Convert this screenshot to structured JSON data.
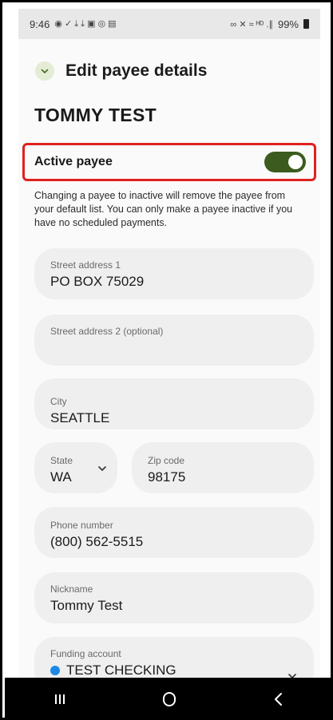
{
  "status_bar": {
    "time": "9:46",
    "left_icons": "◉ ✓ ⤓ ⤓ ▣ ◎ ▤",
    "right_icons": "∞ ✕ ≈ ᴴᴰ .∥",
    "battery": "99%"
  },
  "header": {
    "back_icon": "chevron-down-icon",
    "title": "Edit payee details"
  },
  "payee": {
    "name": "TOMMY TEST"
  },
  "active_payee": {
    "label": "Active payee",
    "enabled": true,
    "toggle_color": "#3b5b1f",
    "highlight_color": "#e02020"
  },
  "help_text": "Changing a payee to inactive will remove the payee from your default list. You can only make a payee inactive if you have no scheduled payments.",
  "fields": {
    "street1": {
      "label": "Street address 1",
      "value": "PO BOX 75029"
    },
    "street2": {
      "label": "Street address 2 (optional)",
      "value": ""
    },
    "city": {
      "label": "City",
      "value": "SEATTLE"
    },
    "state": {
      "label": "State",
      "value": "WA"
    },
    "zip": {
      "label": "Zip code",
      "value": "98175"
    },
    "phone": {
      "label": "Phone number",
      "value": "(800) 562-5515"
    },
    "nickname": {
      "label": "Nickname",
      "value": "Tommy Test"
    },
    "funding": {
      "label": "Funding account",
      "value": "TEST CHECKING",
      "dot_color": "#1e88e5"
    }
  },
  "nav": {
    "recent_icon": "recent-apps-icon",
    "home_icon": "home-icon",
    "back_icon": "back-icon"
  }
}
